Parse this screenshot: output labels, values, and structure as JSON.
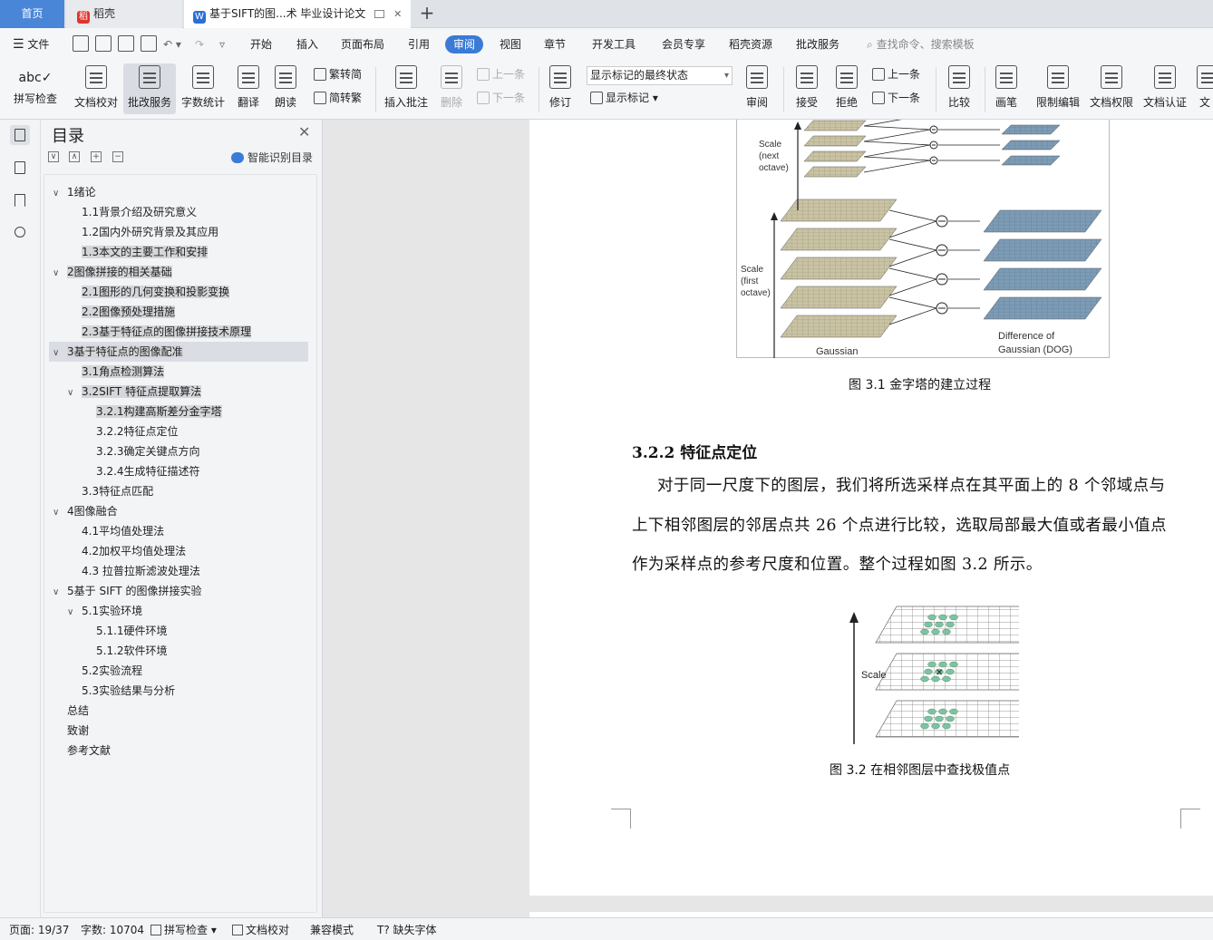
{
  "tabs": {
    "home": "首页",
    "daoke": "稻壳",
    "doc": "基于SIFT的图...术 毕业设计论文",
    "add": "+",
    "doc_close": "✕"
  },
  "menu": {
    "file": "文件",
    "items": [
      "开始",
      "插入",
      "页面布局",
      "引用",
      "审阅",
      "视图",
      "章节",
      "开发工具",
      "会员专享",
      "稻壳资源",
      "批改服务"
    ],
    "active": "审阅",
    "search": "查找命令、搜索模板"
  },
  "ribbon": {
    "spell": "拼写检查",
    "proof": "文档校对",
    "review_service": "批改服务",
    "word_count": "字数统计",
    "translate": "翻译",
    "read": "朗读",
    "trad_to_simp": "繁转简",
    "simp_to_trad": "简转繁",
    "insert_comment": "插入批注",
    "delete": "删除",
    "prev": "上一条",
    "next": "下一条",
    "track": "修订",
    "markup_state": "显示标记的最终状态",
    "show_markup": "显示标记",
    "review_pane": "审阅",
    "accept": "接受",
    "reject": "拒绝",
    "prev2": "上一条",
    "next2": "下一条",
    "compare": "比较",
    "ink": "画笔",
    "restrict": "限制编辑",
    "permission": "文档权限",
    "certify": "文档认证",
    "more": "文"
  },
  "toc": {
    "title": "目录",
    "smart": "智能识别目录",
    "items": [
      {
        "label": "1绪论",
        "twisty": "∨"
      },
      {
        "label": "1.1背景介绍及研究意义"
      },
      {
        "label": "1.2国内外研究背景及其应用"
      },
      {
        "label": "1.3本文的主要工作和安排"
      },
      {
        "label": "2图像拼接的相关基础",
        "twisty": "∨"
      },
      {
        "label": "2.1图形的几何变换和投影变换"
      },
      {
        "label": "2.2图像预处理措施"
      },
      {
        "label": "2.3基于特征点的图像拼接技术原理"
      },
      {
        "label": "3基于特征点的图像配准",
        "twisty": "∨"
      },
      {
        "label": "3.1角点检测算法"
      },
      {
        "label": "3.2SIFT 特征点提取算法",
        "twisty": "∨"
      },
      {
        "label": "3.2.1构建高斯差分金字塔"
      },
      {
        "label": "3.2.2特征点定位"
      },
      {
        "label": "3.2.3确定关键点方向"
      },
      {
        "label": "3.2.4生成特征描述符"
      },
      {
        "label": "3.3特征点匹配"
      },
      {
        "label": "4图像融合",
        "twisty": "∨"
      },
      {
        "label": "4.1平均值处理法"
      },
      {
        "label": "4.2加权平均值处理法"
      },
      {
        "label": "4.3 拉普拉斯滤波处理法"
      },
      {
        "label": "5基于 SIFT 的图像拼接实验",
        "twisty": "∨"
      },
      {
        "label": "5.1实验环境",
        "twisty": "∨"
      },
      {
        "label": "5.1.1硬件环境"
      },
      {
        "label": "5.1.2软件环境"
      },
      {
        "label": "5.2实验流程"
      },
      {
        "label": "5.3实验结果与分析"
      },
      {
        "label": "总结"
      },
      {
        "label": "致谢"
      },
      {
        "label": "参考文献"
      }
    ]
  },
  "document": {
    "fig1": {
      "scale_next": [
        "Scale",
        "(next",
        "octave)"
      ],
      "scale_first": [
        "Scale",
        "(first",
        "octave)"
      ],
      "gaussian": "Gaussian",
      "dog": [
        "Difference of",
        "Gaussian (DOG)"
      ],
      "caption": "图 3.1 金字塔的建立过程"
    },
    "section": "3.2.2  特征点定位",
    "paragraph": [
      "对于同一尺度下的图层，我们将所选采样点在其平面上的 8 个邻域点与",
      "上下相邻图层的邻居点共 26 个点进行比较，选取局部最大值或者最小值点",
      "作为采样点的参考尺度和位置。整个过程如图 3.2 所示。"
    ],
    "fig2": {
      "scale": "Scale",
      "caption": "图 3.2 在相邻图层中查找极值点"
    }
  },
  "status": {
    "page": "页面: 19/37",
    "words": "字数: 10704",
    "spell": "拼写检查",
    "proof": "文档校对",
    "compat": "兼容模式",
    "missing_font": "缺失字体"
  },
  "colors": {
    "accent": "#3a7bd5",
    "gauss_grid": "#c9c3a4",
    "dog_grid": "#7d9bb5",
    "point": "#7ec3a0"
  }
}
